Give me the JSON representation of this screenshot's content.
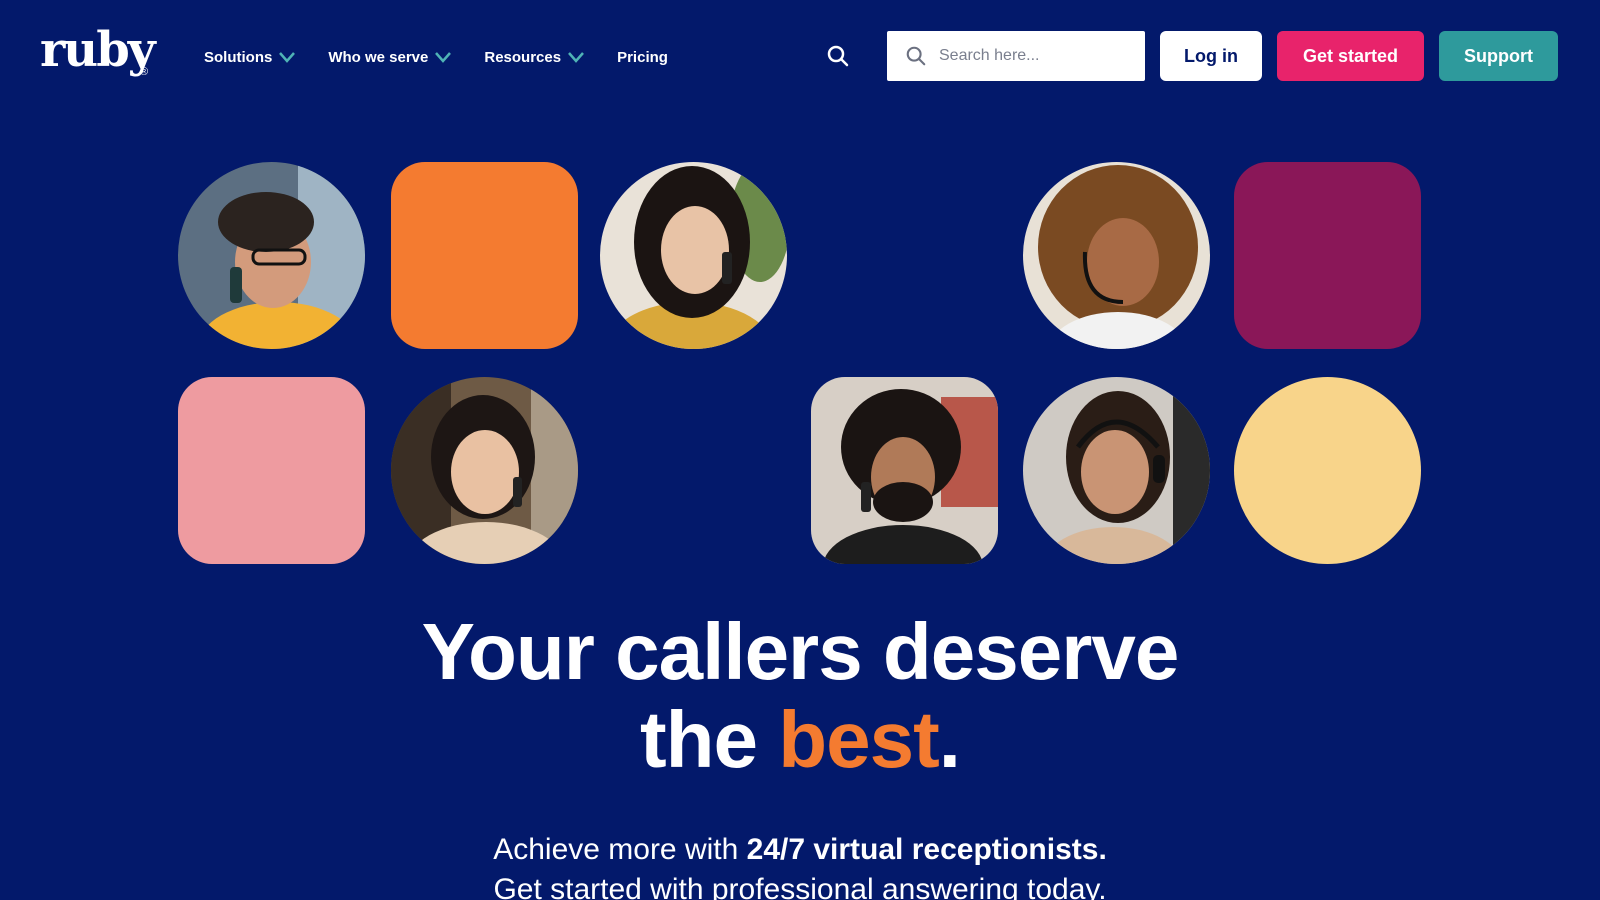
{
  "brand": {
    "logo_text": "ruby",
    "reg_mark": "®"
  },
  "nav": {
    "items": [
      {
        "label": "Solutions",
        "has_dropdown": true
      },
      {
        "label": "Who we serve",
        "has_dropdown": true
      },
      {
        "label": "Resources",
        "has_dropdown": true
      },
      {
        "label": "Pricing",
        "has_dropdown": false
      }
    ],
    "search_placeholder": "Search here...",
    "login_label": "Log in",
    "get_started_label": "Get started",
    "support_label": "Support"
  },
  "hero": {
    "headline_line1": "Your callers deserve",
    "headline_line2_pre": "the ",
    "headline_accent": "best",
    "headline_end": ".",
    "sub_line1_pre": "Achieve more with ",
    "sub_line1_bold": "24/7 virtual receptionists.",
    "sub_line2": "Get started with professional answering today."
  },
  "tiles": [
    {
      "kind": "photo",
      "desc": "woman-glasses-phone"
    },
    {
      "kind": "color",
      "color": "#f47b30"
    },
    {
      "kind": "photo",
      "desc": "woman-phone-smiling"
    },
    {
      "kind": "photo",
      "desc": "woman-headset-curly"
    },
    {
      "kind": "color",
      "color": "#8a1758"
    },
    {
      "kind": "color",
      "color": "#ee9ba0"
    },
    {
      "kind": "photo",
      "desc": "woman-phone-office"
    },
    {
      "kind": "photo",
      "desc": "man-curly-phone"
    },
    {
      "kind": "photo",
      "desc": "woman-headset-mic"
    },
    {
      "kind": "color",
      "color": "#f8d48a"
    }
  ],
  "colors": {
    "background": "#03196b",
    "accent_orange": "#f47b30",
    "cta_pink": "#e8236b",
    "support_teal": "#2e9a9c",
    "chevron_teal": "#4fb3b5"
  }
}
